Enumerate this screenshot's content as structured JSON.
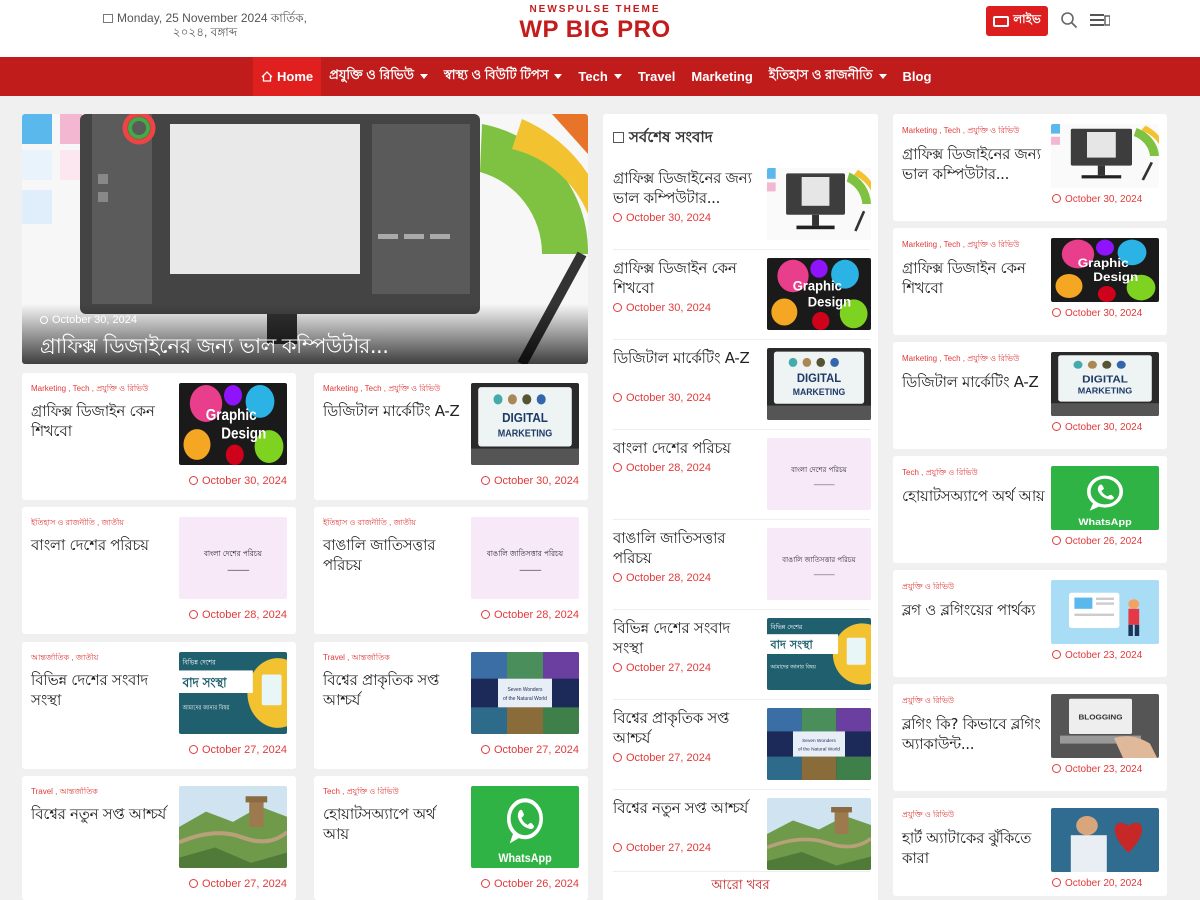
{
  "header": {
    "date_line1": "Monday, 25 November 2024 কার্তিক,",
    "date_line2": "২০২৪, বঙ্গাব্দ",
    "logo_sub": "NEWSPULSE THEME",
    "logo_main": "WP BIG PRO",
    "live_label": "লাইভ"
  },
  "nav": {
    "items": [
      {
        "label": "Home",
        "icon": "home-icon",
        "has_caret": false
      },
      {
        "label": "প্রযুক্তি ও রিভিউ",
        "has_caret": true
      },
      {
        "label": "স্বাস্থ্য ও বিউটি টিপস",
        "has_caret": true
      },
      {
        "label": "Tech",
        "has_caret": true
      },
      {
        "label": "Travel",
        "has_caret": false
      },
      {
        "label": "Marketing",
        "has_caret": false
      },
      {
        "label": "ইতিহাস ও রাজনীতি",
        "has_caret": true
      },
      {
        "label": "Blog",
        "has_caret": false
      }
    ]
  },
  "hero": {
    "date": "October 30, 2024",
    "title": "গ্রাফিক্স ডিজাইনের জন্য ভাল কম্পিউটার..."
  },
  "grid": [
    {
      "meta": "Marketing , Tech , প্রযুক্তি ও রিভিউ",
      "title": "গ্রাফিক্স ডিজাইন কেন শিখবো",
      "date": "October 30, 2024",
      "thumb": "graphic"
    },
    {
      "meta": "Marketing , Tech , প্রযুক্তি ও রিভিউ",
      "title": "ডিজিটাল মার্কেটিং A-Z",
      "date": "October 30, 2024",
      "thumb": "digital"
    },
    {
      "meta": "ইতিহাস ও রাজনীতি , জাতীয়",
      "title": "বাংলা দেশের পরিচয়",
      "date": "October 28, 2024",
      "thumb": "pink1"
    },
    {
      "meta": "ইতিহাস ও রাজনীতি , জাতীয়",
      "title": "বাঙালি জাতিসত্তার পরিচয়",
      "date": "October 28, 2024",
      "thumb": "pink2"
    },
    {
      "meta": "আন্তর্জাতিক , জাতীয়",
      "title": "বিভিন্ন দেশের সংবাদ সংস্থা",
      "date": "October 27, 2024",
      "thumb": "news"
    },
    {
      "meta": "Travel , আন্তর্জাতিক",
      "title": "বিশ্বের প্রাকৃতিক সপ্ত আশ্চর্য",
      "date": "October 27, 2024",
      "thumb": "wonders"
    },
    {
      "meta": "Travel , আন্তর্জাতিক",
      "title": "বিশ্বের নতুন সপ্ত আশ্চর্য",
      "date": "October 27, 2024",
      "thumb": "wall"
    },
    {
      "meta": "Tech , প্রযুক্তি ও রিভিউ",
      "title": "হোয়াটসঅ্যাপে অর্থ আয়",
      "date": "October 26, 2024",
      "thumb": "whatsapp"
    }
  ],
  "latest": {
    "heading": "সর্বশেষ সংবাদ",
    "items": [
      {
        "title": "গ্রাফিক্স ডিজাইনের জন্য ভাল কম্পিউটার...",
        "date": "October 30, 2024",
        "thumb": "computer"
      },
      {
        "title": "গ্রাফিক্স ডিজাইন কেন শিখবো",
        "date": "October 30, 2024",
        "thumb": "graphic"
      },
      {
        "title": "ডিজিটাল মার্কেটিং A-Z",
        "date": "October 30, 2024",
        "thumb": "digital"
      },
      {
        "title": "বাংলা দেশের পরিচয়",
        "date": "October 28, 2024",
        "thumb": "pink1"
      },
      {
        "title": "বাঙালি জাতিসত্তার পরিচয়",
        "date": "October 28, 2024",
        "thumb": "pink2"
      },
      {
        "title": "বিভিন্ন দেশের সংবাদ সংস্থা",
        "date": "October 27, 2024",
        "thumb": "news"
      },
      {
        "title": "বিশ্বের প্রাকৃতিক সপ্ত আশ্চর্য",
        "date": "October 27, 2024",
        "thumb": "wonders"
      },
      {
        "title": "বিশ্বের নতুন সপ্ত আশ্চর্য",
        "date": "October 27, 2024",
        "thumb": "wall"
      }
    ],
    "more_label": "আরো খবর"
  },
  "side": [
    {
      "meta": "Marketing , Tech , প্রযুক্তি ও রিভিউ",
      "title": "গ্রাফিক্স ডিজাইনের জন্য ভাল কম্পিউটার...",
      "date": "October 30, 2024",
      "thumb": "computer"
    },
    {
      "meta": "Marketing , Tech , প্রযুক্তি ও রিভিউ",
      "title": "গ্রাফিক্স ডিজাইন কেন শিখবো",
      "date": "October 30, 2024",
      "thumb": "graphic"
    },
    {
      "meta": "Marketing , Tech , প্রযুক্তি ও রিভিউ",
      "title": "ডিজিটাল মার্কেটিং A-Z",
      "date": "October 30, 2024",
      "thumb": "digital"
    },
    {
      "meta": "Tech , প্রযুক্তি ও রিভিউ",
      "title": "হোয়াটসঅ্যাপে অর্থ আয়",
      "date": "October 26, 2024",
      "thumb": "whatsapp"
    },
    {
      "meta": "প্রযুক্তি ও রিভিউ",
      "title": "ব্লগ ও ব্লগিংয়ের পার্থক্য",
      "date": "October 23, 2024",
      "thumb": "blog"
    },
    {
      "meta": "প্রযুক্তি ও রিভিউ",
      "title": "ব্লগিং কি? কিভাবে ব্লগিং অ্যাকাউন্ট...",
      "date": "October 23, 2024",
      "thumb": "blogging"
    },
    {
      "meta": "প্রযুক্তি ও রিভিউ",
      "title": "হার্ট অ্যাটাকের ঝুঁকিতে কারা",
      "date": "October 20, 2024",
      "thumb": "heart"
    }
  ],
  "thumb_text": {
    "graphic": "Graphic Design",
    "digital": "DIGITAL MARKETING",
    "pink1": "বাংলা দেশের পরিচয়",
    "pink2": "বাঙালি জাতিসত্তার পরিচয়",
    "news": "বাদ সংস্থা",
    "news_top": "বিভিন্ন দেশের",
    "news_sub": "আমাদের জানার বিষয়",
    "wonders": "Seven Wonders of the Natural World",
    "whatsapp": "WhatsApp",
    "blogging": "BLOGGING"
  },
  "colors": {
    "brand": "#c31c1c",
    "nav_bg": "#c01c1c",
    "accent": "#e23a3a",
    "whatsapp": "#25b43c"
  }
}
